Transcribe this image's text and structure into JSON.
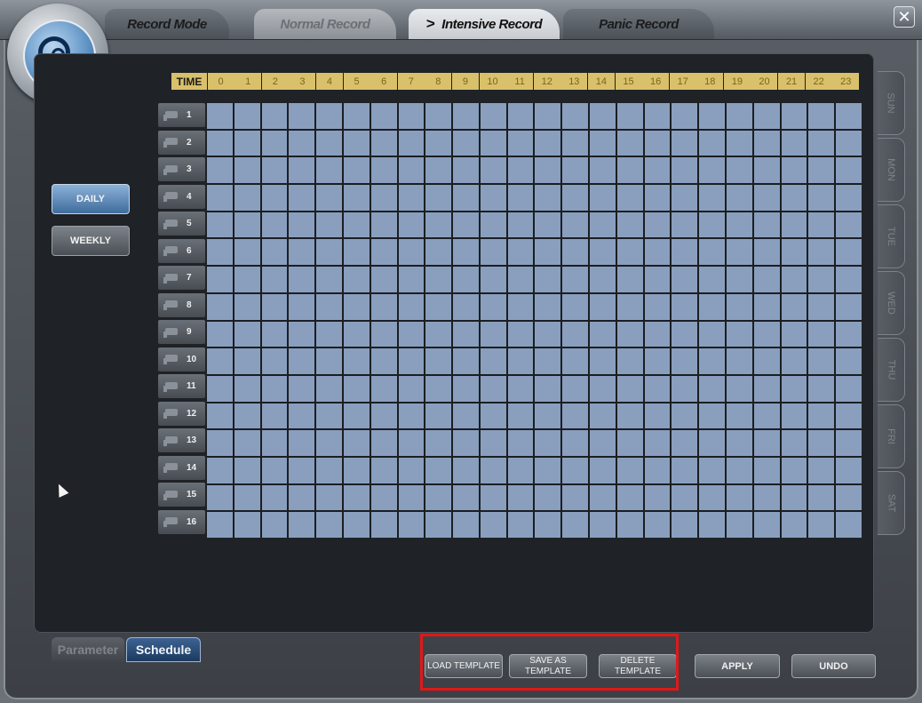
{
  "tabs": [
    {
      "label": "Record Mode"
    },
    {
      "label": "Normal Record"
    },
    {
      "label": "Intensive Record",
      "active": true
    },
    {
      "label": "Panic Record"
    }
  ],
  "close_symbol": "✕",
  "schedule": {
    "time_label": "TIME",
    "hours": [
      "0",
      "1",
      "2",
      "3",
      "4",
      "5",
      "6",
      "7",
      "8",
      "9",
      "10",
      "11",
      "12",
      "13",
      "14",
      "15",
      "16",
      "17",
      "18",
      "19",
      "20",
      "21",
      "22",
      "23"
    ],
    "cameras": [
      "1",
      "2",
      "3",
      "4",
      "5",
      "6",
      "7",
      "8",
      "9",
      "10",
      "11",
      "12",
      "13",
      "14",
      "15",
      "16"
    ]
  },
  "modes": {
    "daily": "DAILY",
    "weekly": "WEEKLY"
  },
  "days": [
    "SUN",
    "MON",
    "TUE",
    "WED",
    "THU",
    "FRI",
    "SAT"
  ],
  "bottom_tabs": {
    "parameter": "Parameter",
    "schedule": "Schedule"
  },
  "actions": {
    "load_template": "LOAD TEMPLATE",
    "save_as_template": "SAVE AS TEMPLATE",
    "delete_template": "DELETE TEMPLATE",
    "apply": "APPLY",
    "undo": "UNDO"
  },
  "colors": {
    "cell": "#8a9fbe",
    "time_header": "#d9c06a",
    "highlight": "#e01818",
    "active_blue": "#3f6c9c"
  }
}
